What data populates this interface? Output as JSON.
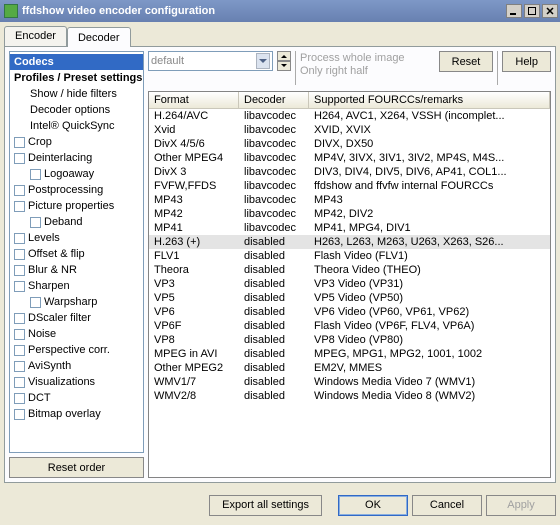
{
  "window": {
    "title": "ffdshow video encoder configuration"
  },
  "tabs": {
    "encoder": "Encoder",
    "decoder": "Decoder"
  },
  "preset": {
    "value": "default"
  },
  "process": {
    "line1": "Process whole image",
    "line2": "Only right half"
  },
  "buttons": {
    "reset": "Reset",
    "help": "Help",
    "reset_order": "Reset order",
    "export": "Export all settings",
    "ok": "OK",
    "cancel": "Cancel",
    "apply": "Apply"
  },
  "tree": [
    {
      "label": "Codecs",
      "bold": true,
      "sel": true
    },
    {
      "label": "Profiles / Preset settings",
      "bold": true
    },
    {
      "label": "Show / hide filters",
      "sub": true
    },
    {
      "label": "Decoder options",
      "sub": true
    },
    {
      "label": "Intel® QuickSync",
      "sub": true
    },
    {
      "label": "Crop",
      "cb": true
    },
    {
      "label": "Deinterlacing",
      "cb": true
    },
    {
      "label": "Logoaway",
      "cb": true,
      "nested": true
    },
    {
      "label": "Postprocessing",
      "cb": true
    },
    {
      "label": "Picture properties",
      "cb": true
    },
    {
      "label": "Deband",
      "cb": true,
      "nested": true
    },
    {
      "label": "Levels",
      "cb": true
    },
    {
      "label": "Offset & flip",
      "cb": true
    },
    {
      "label": "Blur & NR",
      "cb": true
    },
    {
      "label": "Sharpen",
      "cb": true
    },
    {
      "label": "Warpsharp",
      "cb": true,
      "nested": true
    },
    {
      "label": "DScaler filter",
      "cb": true
    },
    {
      "label": "Noise",
      "cb": true
    },
    {
      "label": "Perspective corr.",
      "cb": true
    },
    {
      "label": "AviSynth",
      "cb": true
    },
    {
      "label": "Visualizations",
      "cb": true
    },
    {
      "label": "DCT",
      "cb": true
    },
    {
      "label": "Bitmap overlay",
      "cb": true
    }
  ],
  "table": {
    "headers": {
      "format": "Format",
      "decoder": "Decoder",
      "remarks": "Supported FOURCCs/remarks"
    },
    "rows": [
      {
        "f": "H.264/AVC",
        "d": "libavcodec",
        "r": "H264, AVC1, X264, VSSH (incomplet..."
      },
      {
        "f": "Xvid",
        "d": "libavcodec",
        "r": "XVID, XVIX"
      },
      {
        "f": "DivX 4/5/6",
        "d": "libavcodec",
        "r": "DIVX, DX50"
      },
      {
        "f": "Other MPEG4",
        "d": "libavcodec",
        "r": "MP4V, 3IVX, 3IV1, 3IV2, MP4S, M4S..."
      },
      {
        "f": "DivX 3",
        "d": "libavcodec",
        "r": "DIV3, DIV4, DIV5, DIV6, AP41, COL1..."
      },
      {
        "f": "FVFW,FFDS",
        "d": "libavcodec",
        "r": "ffdshow and ffvfw internal FOURCCs"
      },
      {
        "f": "MP43",
        "d": "libavcodec",
        "r": "MP43"
      },
      {
        "f": "MP42",
        "d": "libavcodec",
        "r": "MP42, DIV2"
      },
      {
        "f": "MP41",
        "d": "libavcodec",
        "r": "MP41, MPG4, DIV1"
      },
      {
        "f": "H.263 (+)",
        "d": "disabled",
        "r": "H263, L263, M263, U263, X263, S26...",
        "sel": true
      },
      {
        "f": "FLV1",
        "d": "disabled",
        "r": "Flash Video (FLV1)"
      },
      {
        "f": "Theora",
        "d": "disabled",
        "r": "Theora Video (THEO)"
      },
      {
        "f": "VP3",
        "d": "disabled",
        "r": "VP3 Video (VP31)"
      },
      {
        "f": "VP5",
        "d": "disabled",
        "r": "VP5 Video (VP50)"
      },
      {
        "f": "VP6",
        "d": "disabled",
        "r": "VP6 Video (VP60, VP61, VP62)"
      },
      {
        "f": "VP6F",
        "d": "disabled",
        "r": "Flash Video (VP6F, FLV4, VP6A)"
      },
      {
        "f": "VP8",
        "d": "disabled",
        "r": "VP8 Video (VP80)"
      },
      {
        "f": "MPEG in AVI",
        "d": "disabled",
        "r": "MPEG, MPG1, MPG2, 1001, 1002"
      },
      {
        "f": "Other MPEG2",
        "d": "disabled",
        "r": "EM2V, MMES"
      },
      {
        "f": "WMV1/7",
        "d": "disabled",
        "r": "Windows Media Video 7 (WMV1)"
      },
      {
        "f": "WMV2/8",
        "d": "disabled",
        "r": "Windows Media Video 8 (WMV2)"
      }
    ]
  }
}
